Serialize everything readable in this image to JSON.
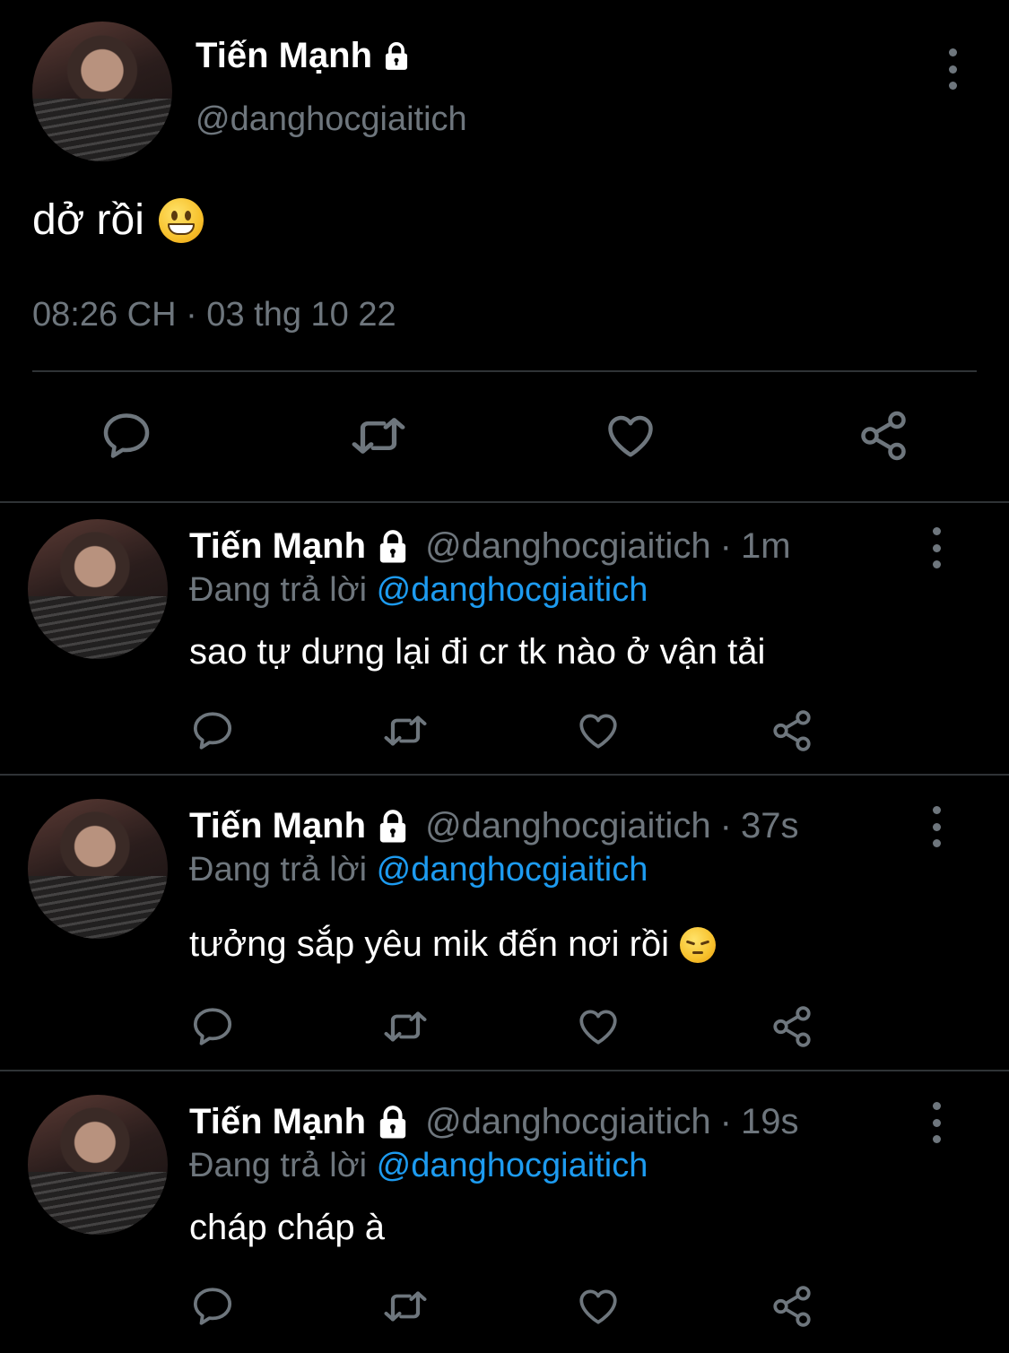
{
  "main_tweet": {
    "display_name": "Tiến Mạnh",
    "handle": "@danghocgiaitich",
    "text": "dở rồi",
    "emoji": "grinning-face",
    "timestamp": "08:26 CH · 03 thg 10 22",
    "actions": [
      "reply-icon",
      "retweet-icon",
      "like-icon",
      "share-icon"
    ]
  },
  "replies": [
    {
      "display_name": "Tiến Mạnh",
      "handle": "@danghocgiaitich",
      "separator": "·",
      "time": "1m",
      "replying_label": "Đang trả lời",
      "replying_to": "@danghocgiaitich",
      "text": "sao tự dưng lại đi cr tk nào ở vận tải"
    },
    {
      "display_name": "Tiến Mạnh",
      "handle": "@danghocgiaitich",
      "separator": "·",
      "time": "37s",
      "replying_label": "Đang trả lời",
      "replying_to": "@danghocgiaitich",
      "text": "tưởng sắp yêu mik đến nơi rồi",
      "emoji": "pensive-face"
    },
    {
      "display_name": "Tiến Mạnh",
      "handle": "@danghocgiaitich",
      "separator": "·",
      "time": "19s",
      "replying_label": "Đang trả lời",
      "replying_to": "@danghocgiaitich",
      "text": "cháp cháp à"
    }
  ],
  "colors": {
    "background": "#000000",
    "text_primary": "#ffffff",
    "text_secondary": "#6e767d",
    "mention": "#1d9bf0",
    "divider": "#2f3336"
  }
}
